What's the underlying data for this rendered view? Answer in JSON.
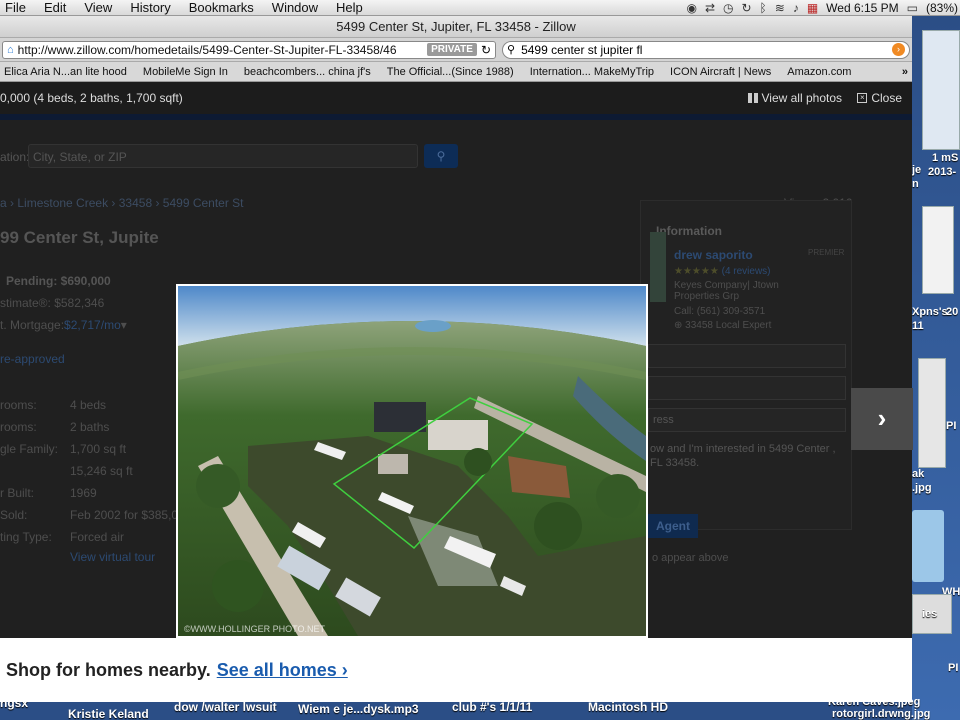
{
  "menubar": {
    "app": "File",
    "items": [
      "Edit",
      "View",
      "History",
      "Bookmarks",
      "Window",
      "Help"
    ],
    "clock": "Wed 6:15 PM",
    "battery": "(83%)"
  },
  "window": {
    "title": "5499 Center St, Jupiter, FL 33458 - Zillow",
    "url": "http://www.zillow.com/homedetails/5499-Center-St-Jupiter-FL-33458/46",
    "private_label": "PRIVATE",
    "search_value": "5499 center st jupiter fl"
  },
  "bookmarks": [
    "Elica Aria N...an lite hood",
    "MobileMe Sign In",
    "beachcombers... china jf's",
    "The Official...(Since 1988)",
    "Internation... MakeMyTrip",
    "ICON Aircraft | News",
    "Amazon.com"
  ],
  "lightbox": {
    "header_text": "0,000 (4 beds, 2 baths, 1,700 sqft)",
    "view_all_label": "View all photos",
    "close_label": "Close",
    "next_label": "›",
    "watermark": "©WWW.HOLLINGER PHOTO.NET"
  },
  "page": {
    "search_label": "ation:",
    "search_placeholder": "City, State, or ZIP",
    "breadcrumb": [
      "a",
      "Limestone Creek",
      "33458",
      "5499 Center St"
    ],
    "views": "Views: 2,010",
    "address": "99 Center St, Jupite",
    "pending": "Pending: $690,000",
    "zestimate": "stimate®: $582,346",
    "mortgage_label": "t. Mortgage:",
    "mortgage_value": "$2,717/mo",
    "preapproved": "re-approved",
    "facts": [
      {
        "label": "rooms:",
        "value": "4 beds"
      },
      {
        "label": "rooms:",
        "value": "2 baths"
      },
      {
        "label": "gle Family:",
        "value": "1,700 sq ft"
      },
      {
        "label": "",
        "value": "15,246 sq ft"
      },
      {
        "label": "r Built:",
        "value": "1969"
      },
      {
        "label": "Sold:",
        "value": "Feb 2002 for $385,0"
      },
      {
        "label": "ting Type:",
        "value": "Forced air"
      }
    ],
    "virtual_tour": "View virtual tour",
    "agent_heading": "Information",
    "agent_name": "drew saporito",
    "agent_badge": "PREMIER",
    "agent_reviews": "(4 reviews)",
    "agent_company": "Keyes Company| Jtown Properties Grp",
    "agent_phone": "Call: (561) 309-3571",
    "agent_expert": "33458 Local Expert",
    "address_field": "ress",
    "message": "ow and I'm interested in 5499 Center , FL 33458.",
    "contact_btn": "Agent",
    "appear_note": "o appear above"
  },
  "shop": {
    "text": "Shop for homes nearby.",
    "link": "See all homes ›"
  },
  "desktop": {
    "right_labels": [
      "1 mS",
      "2013-",
      "je",
      "n",
      "Xpns's",
      "11",
      "20",
      "PI",
      "ak",
      ".jpg",
      "WH",
      "ies",
      "PI"
    ],
    "bottom_labels": [
      "ngsx",
      "Kristie Keland",
      "dow /walter lwsuit",
      "Wiem e je...dysk.mp3",
      "club #'s 1/1/11",
      "Macintosh HD",
      "Karen Caves.jpeg",
      "rotorgirl.drwng.jpg",
      "karen johnso.jpg"
    ]
  },
  "colors": {
    "menubar": "#d9d9d9",
    "page_bg": "#202020",
    "link_blue": "#1a5cae",
    "desktop_blue": "#2b4e86"
  }
}
